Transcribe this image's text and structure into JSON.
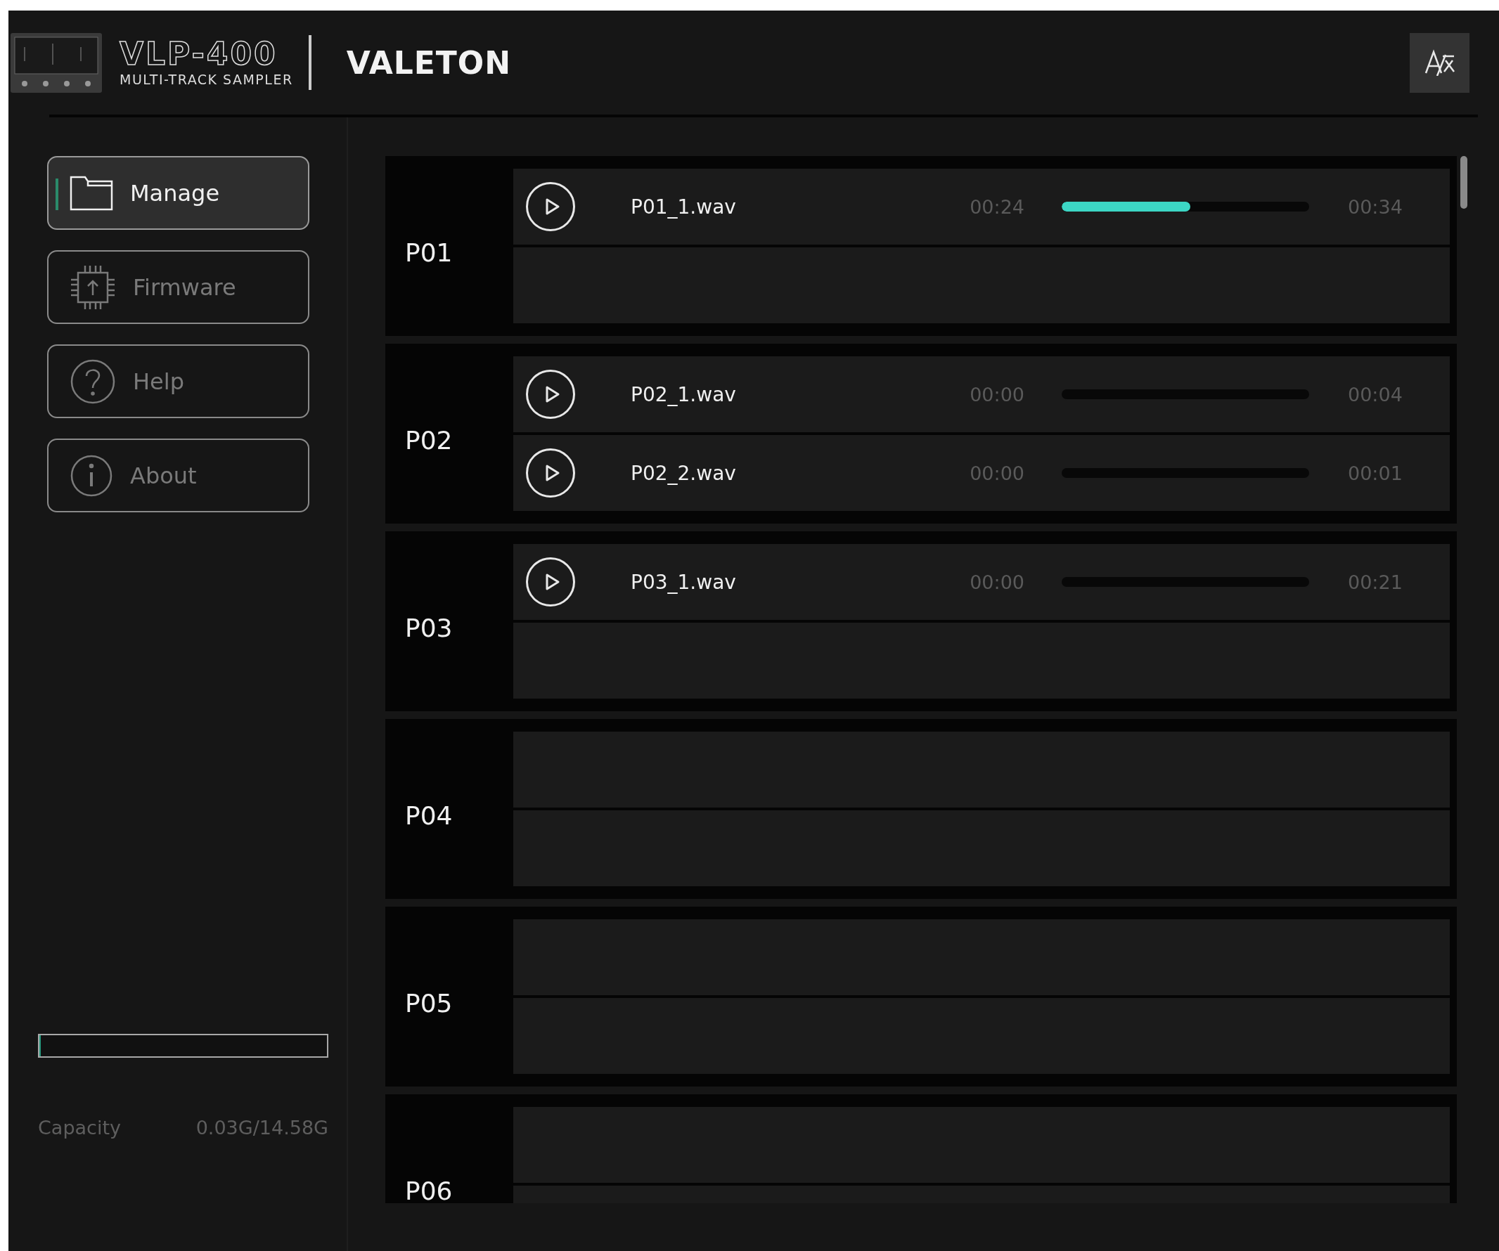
{
  "header": {
    "model": "VLP-400",
    "subtitle": "MULTI-TRACK SAMPLER",
    "brand": "VALETON"
  },
  "nav": [
    {
      "label": "Manage",
      "selected": true
    },
    {
      "label": "Firmware",
      "selected": false
    },
    {
      "label": "Help",
      "selected": false
    },
    {
      "label": "About",
      "selected": false
    }
  ],
  "capacity": {
    "level": 0.004,
    "label": "Capacity",
    "value": "0.03G/14.58G"
  },
  "groups": [
    {
      "label": "P01",
      "tracks": [
        {
          "name": "P01_1.wav",
          "current": "00:24",
          "level": 0.52,
          "total": "00:34"
        }
      ]
    },
    {
      "label": "P02",
      "tracks": [
        {
          "name": "P02_1.wav",
          "current": "00:00",
          "level": 0,
          "total": "00:04"
        },
        {
          "name": "P02_2.wav",
          "current": "00:00",
          "level": 0,
          "total": "00:01"
        }
      ]
    },
    {
      "label": "P03",
      "tracks": [
        {
          "name": "P03_1.wav",
          "current": "00:00",
          "level": 0,
          "total": "00:21"
        }
      ]
    },
    {
      "label": "P04"
    },
    {
      "label": "P05"
    },
    {
      "label": "P06"
    }
  ]
}
